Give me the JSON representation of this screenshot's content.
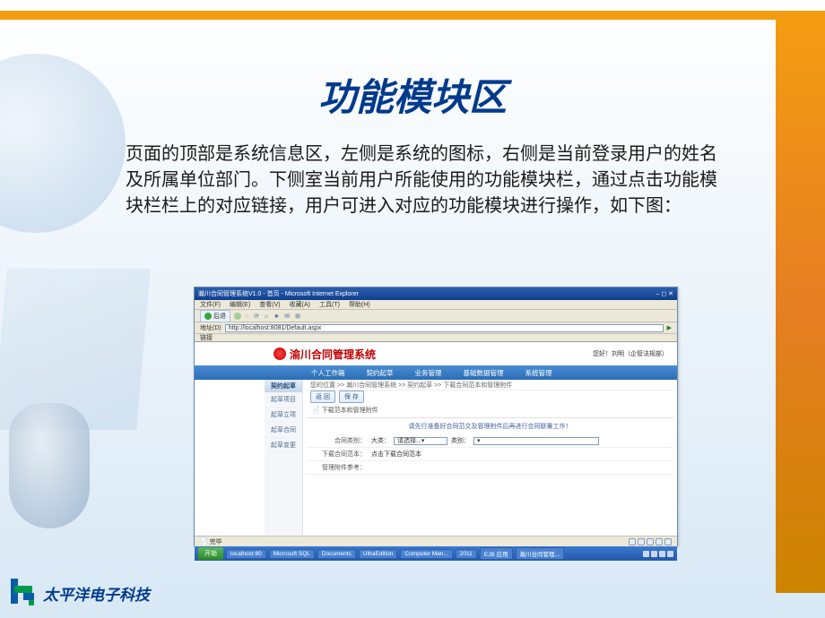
{
  "slide": {
    "title": "功能模块区",
    "body": "页面的顶部是系统信息区，左侧是系统的图标，右侧是当前登录用户的姓名及所属单位部门。下侧室当前用户所能使用的功能模块栏，通过点击功能模块栏栏上的对应链接，用户可进入对应的功能模块进行操作，如下图："
  },
  "screenshot": {
    "browser": {
      "title": "瀚川合同管理系统V1.0 - 首页 - Microsoft Internet Explorer",
      "menu": [
        "文件(F)",
        "编辑(E)",
        "查看(V)",
        "收藏(A)",
        "工具(T)",
        "帮助(H)"
      ],
      "back_label": "后退",
      "addr_label": "地址(D)",
      "addr_url": "http://localhost:8081/Default.aspx",
      "links_label": "链接"
    },
    "app": {
      "title": "渝川合同管理系统",
      "user_info": "您好！刘明（企管法规部）",
      "nav": [
        "个人工作箱",
        "契约起草",
        "业务管理",
        "基础数据管理",
        "系统管理"
      ],
      "sidebar": {
        "header": "契约起草",
        "items": [
          "起草项目",
          "起草立项",
          "起草合同",
          "起草变更"
        ]
      },
      "breadcrumb": "您的位置 >> 瀚川合同管理系统 >> 契约起草 >> 下载合同范本和管理附件",
      "action_buttons": [
        "返 回",
        "保 存"
      ],
      "section_title": "下载范本和管理附件",
      "hint_text": "请先行准备好合同范文及管理附件后再进行合同联署工作！",
      "form": {
        "row1_label": "合同类别：",
        "row1_field1_label": "大类：",
        "row1_field1_value": "请选择...",
        "row1_field2_label": "类别：",
        "row2_label": "下载合同范本：",
        "row2_text": "点击下载合同范本",
        "row3_label": "管理附件参考："
      }
    },
    "status": {
      "done": "完毕"
    },
    "taskbar": {
      "start": "开始",
      "items": [
        "localhost:80",
        "Microsoft SQL",
        "Documents",
        "UltraEdition",
        "Computer Man...",
        "2011",
        "EJB 应用",
        "瀚川合同管理..."
      ]
    }
  },
  "footer": {
    "company": "太平洋电子科技"
  }
}
